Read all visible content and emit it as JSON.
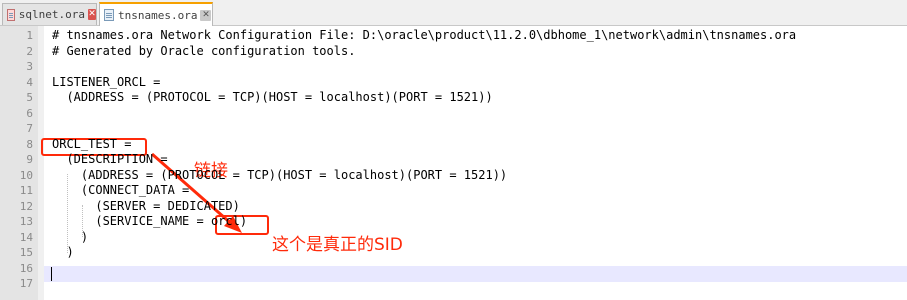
{
  "tabs": [
    {
      "label": "sqlnet.ora",
      "close": "✕",
      "active": false
    },
    {
      "label": "tnsnames.ora",
      "close": "✕",
      "active": true
    }
  ],
  "lines": [
    {
      "n": "1",
      "text": "# tnsnames.ora Network Configuration File: D:\\oracle\\product\\11.2.0\\dbhome_1\\network\\admin\\tnsnames.ora"
    },
    {
      "n": "2",
      "text": "# Generated by Oracle configuration tools."
    },
    {
      "n": "3",
      "text": ""
    },
    {
      "n": "4",
      "text": "LISTENER_ORCL ="
    },
    {
      "n": "5",
      "text": "  (ADDRESS = (PROTOCOL = TCP)(HOST = localhost)(PORT = 1521))"
    },
    {
      "n": "6",
      "text": ""
    },
    {
      "n": "7",
      "text": ""
    },
    {
      "n": "8",
      "text": "ORCL_TEST ="
    },
    {
      "n": "9",
      "text": "  (DESCRIPTION ="
    },
    {
      "n": "10",
      "text": "    (ADDRESS = (PROTOCOL = TCP)(HOST = localhost)(PORT = 1521))"
    },
    {
      "n": "11",
      "text": "    (CONNECT_DATA ="
    },
    {
      "n": "12",
      "text": "      (SERVER = DEDICATED)"
    },
    {
      "n": "13",
      "text": "      (SERVICE_NAME = orcl)"
    },
    {
      "n": "14",
      "text": "    )"
    },
    {
      "n": "15",
      "text": "  )"
    },
    {
      "n": "16",
      "text": ""
    },
    {
      "n": "17",
      "text": ""
    }
  ],
  "annotations": {
    "link_label": "链接",
    "sid_label": "这个是真正的SID",
    "color": "#ff2a0a"
  },
  "colors": {
    "current_line": "#e8e8ff",
    "gutter": "#e4e4e4",
    "active_tab_accent": "#f6a000"
  }
}
